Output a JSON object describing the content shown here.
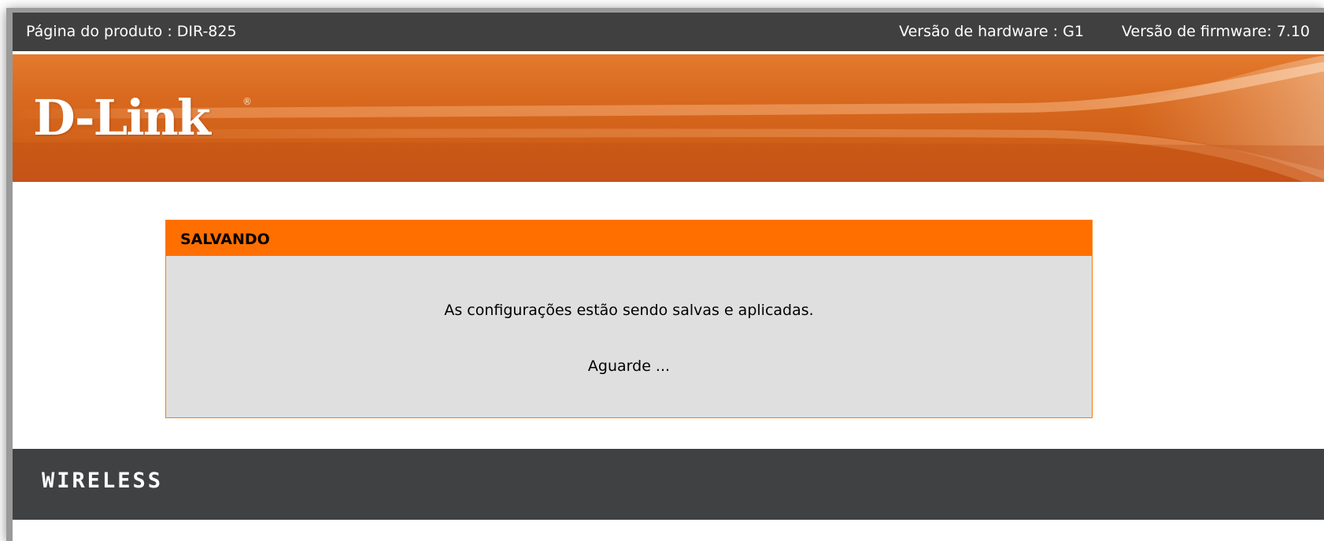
{
  "header": {
    "product_label": "Página do produto :",
    "product_value": "DIR-825",
    "hardware_label": "Versão de hardware :",
    "hardware_value": "G1",
    "firmware_label": "Versão de firmware:",
    "firmware_value": "7.10"
  },
  "banner": {
    "logo_text": "D-Link",
    "logo_mark": "®"
  },
  "panel": {
    "title": "SALVANDO",
    "message": "As configurações estão sendo salvas e aplicadas.",
    "wait_text": "Aguarde ..."
  },
  "footer": {
    "brand_text": "WIRELESS"
  }
}
